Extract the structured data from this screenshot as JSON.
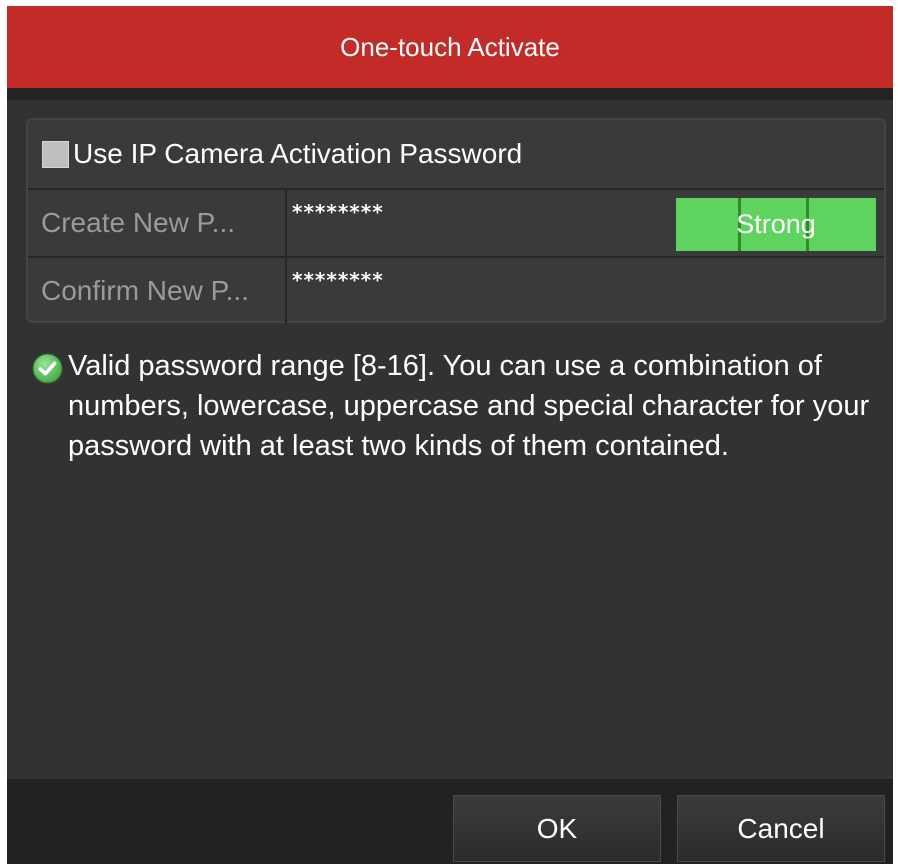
{
  "dialog": {
    "title": "One-touch Activate"
  },
  "form": {
    "use_ip_camera_password": {
      "label": "Use IP Camera Activation Password",
      "checked": false
    },
    "create_password": {
      "label": "Create New P...",
      "value": "********"
    },
    "password_strength": "Strong",
    "confirm_password": {
      "label": "Confirm New P...",
      "value": "********"
    }
  },
  "hint": {
    "icon": "check-circle-icon",
    "text": "Valid password range [8-16]. You can use a combination of numbers, lowercase, uppercase and special character for your password with at least two kinds of them contained."
  },
  "buttons": {
    "ok": "OK",
    "cancel": "Cancel"
  },
  "colors": {
    "title_bar": "#c32b28",
    "dialog_bg": "#323232",
    "strength_strong": "#5ed35e",
    "hint_icon": "#5cc15c"
  }
}
